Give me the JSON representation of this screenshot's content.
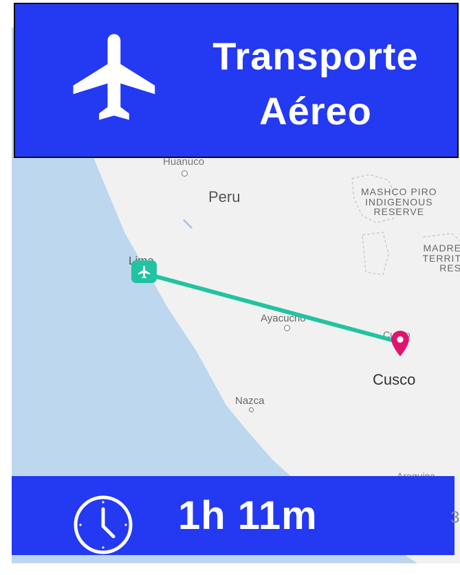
{
  "header": {
    "title_line1": "Transporte",
    "title_line2": "Aéreo",
    "icon": "airplane-icon",
    "background_color": "#2439f2",
    "text_color": "#ffffff"
  },
  "map": {
    "labels": {
      "huanuco": "Huanuco",
      "peru": "Peru",
      "reserve_line1": "MASHCO PIRO",
      "reserve_line2": "INDIGENOUS",
      "reserve_line3": "RESERVE",
      "madre_line1": "MADRE",
      "madre_line2": "TERRIT",
      "madre_line3": "RES",
      "lima": "Lima",
      "ayacucho": "Ayacucho",
      "cusco_small": "Cusco",
      "cusco": "Cusco",
      "nazca": "Nazca",
      "arequipa": "Arequipa"
    },
    "route_color": "#22c3a0",
    "origin_marker_icon": "airplane-icon",
    "destination_marker_icon": "map-pin-icon",
    "destination_color": "#e0136f",
    "ocean_color": "#bcd7ee",
    "land_color": "#f1f1f1"
  },
  "footer": {
    "duration": "1h 11m",
    "icon": "clock-icon",
    "background_color": "#2439f2"
  }
}
